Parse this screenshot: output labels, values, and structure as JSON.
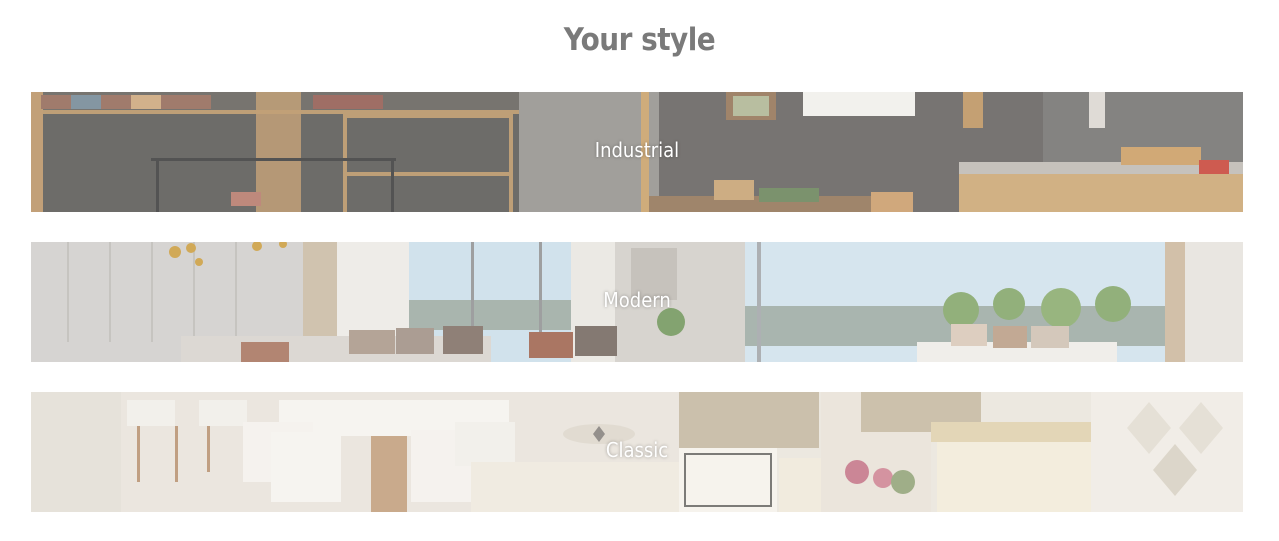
{
  "page": {
    "title": "Your style"
  },
  "styles": [
    {
      "label": "Industrial"
    },
    {
      "label": "Modern"
    },
    {
      "label": "Classic"
    }
  ],
  "colors": {
    "title": "#7a7a7a",
    "label": "#ffffff",
    "background": "#ffffff"
  }
}
